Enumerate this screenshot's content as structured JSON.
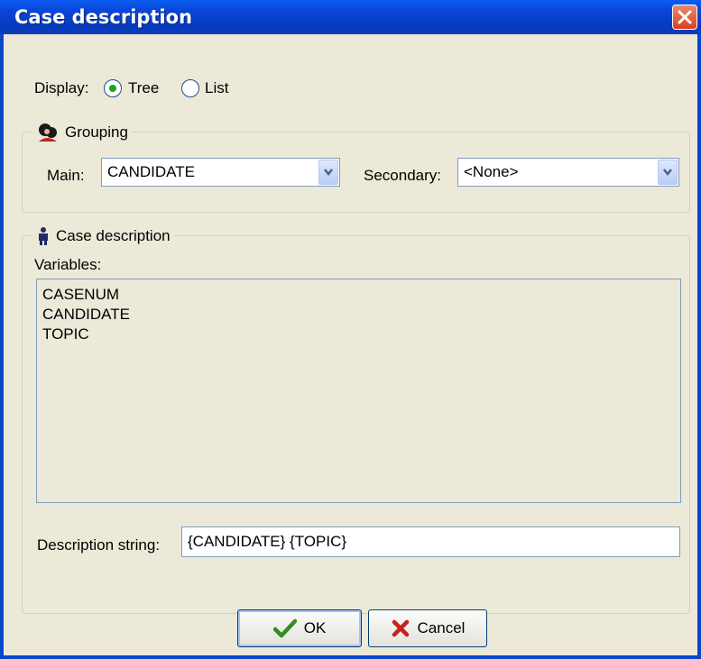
{
  "window": {
    "title": "Case description"
  },
  "display": {
    "label": "Display:",
    "options": [
      {
        "label": "Tree",
        "checked": true
      },
      {
        "label": "List",
        "checked": false
      }
    ]
  },
  "grouping": {
    "legend": "Grouping",
    "main_label": "Main:",
    "main_value": "CANDIDATE",
    "secondary_label": "Secondary:",
    "secondary_value": "<None>"
  },
  "case_description": {
    "legend": "Case description",
    "variables_label": "Variables:",
    "variables": [
      "CASENUM",
      "CANDIDATE",
      "TOPIC"
    ],
    "description_label": "Description string:",
    "description_value": "{CANDIDATE} {TOPIC}"
  },
  "buttons": {
    "ok_label": "OK",
    "cancel_label": "Cancel"
  },
  "colors": {
    "titlebar": "#0a46d8",
    "dialog_bg": "#ece9d8",
    "close": "#d6411d"
  }
}
